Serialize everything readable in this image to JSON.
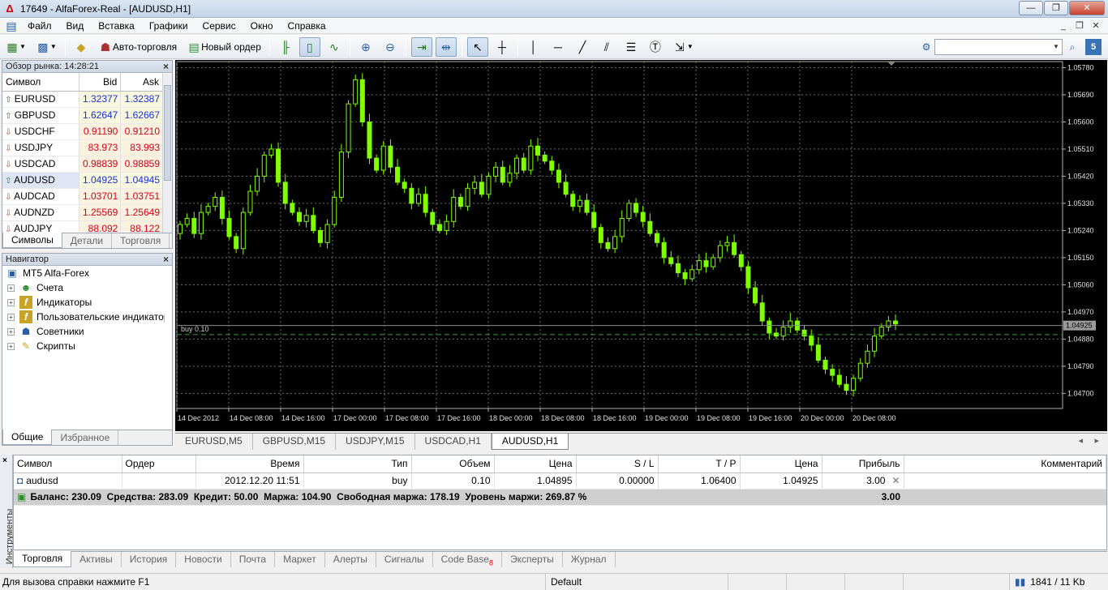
{
  "window": {
    "title": "17649 - AlfaForex-Real - [AUDUSD,H1]"
  },
  "menu": [
    "Файл",
    "Вид",
    "Вставка",
    "Графики",
    "Сервис",
    "Окно",
    "Справка"
  ],
  "toolbar": {
    "auto_trading": "Авто-торговля",
    "new_order": "Новый ордер"
  },
  "market_watch": {
    "title": "Обзор рынка: 14:28:21",
    "columns": {
      "symbol": "Символ",
      "bid": "Bid",
      "ask": "Ask"
    },
    "rows": [
      {
        "symbol": "EURUSD",
        "bid": "1.32377",
        "ask": "1.32387",
        "dir": "up"
      },
      {
        "symbol": "GBPUSD",
        "bid": "1.62647",
        "ask": "1.62667",
        "dir": "up"
      },
      {
        "symbol": "USDCHF",
        "bid": "0.91190",
        "ask": "0.91210",
        "dir": "down"
      },
      {
        "symbol": "USDJPY",
        "bid": "83.973",
        "ask": "83.993",
        "dir": "down"
      },
      {
        "symbol": "USDCAD",
        "bid": "0.98839",
        "ask": "0.98859",
        "dir": "down"
      },
      {
        "symbol": "AUDUSD",
        "bid": "1.04925",
        "ask": "1.04945",
        "dir": "up"
      },
      {
        "symbol": "AUDCAD",
        "bid": "1.03701",
        "ask": "1.03751",
        "dir": "down"
      },
      {
        "symbol": "AUDNZD",
        "bid": "1.25569",
        "ask": "1.25649",
        "dir": "down"
      },
      {
        "symbol": "AUDJPY",
        "bid": "88.092",
        "ask": "88.122",
        "dir": "down"
      }
    ],
    "tabs": [
      "Символы",
      "Детали",
      "Торговля"
    ],
    "colors": {
      "bid_up": "#1a2fd6",
      "bid_down": "#d6001a"
    }
  },
  "navigator": {
    "title": "Навигатор",
    "root": "MT5 Alfa-Forex",
    "items": [
      "Счета",
      "Индикаторы",
      "Пользовательские индикаторы",
      "Советники",
      "Скрипты"
    ],
    "tabs": [
      "Общие",
      "Избранное"
    ]
  },
  "chart": {
    "position_label": "buy 0.10",
    "current_price": "1.04925",
    "y_ticks": [
      "1.05780",
      "1.05690",
      "1.05600",
      "1.05510",
      "1.05420",
      "1.05330",
      "1.05240",
      "1.05150",
      "1.05060",
      "1.04970",
      "1.04880",
      "1.04790",
      "1.04700"
    ],
    "x_ticks": [
      "14 Dec 2012",
      "14 Dec 08:00",
      "14 Dec 16:00",
      "17 Dec 00:00",
      "17 Dec 08:00",
      "17 Dec 16:00",
      "18 Dec 00:00",
      "18 Dec 08:00",
      "18 Dec 16:00",
      "19 Dec 00:00",
      "19 Dec 08:00",
      "19 Dec 16:00",
      "20 Dec 00:00",
      "20 Dec 08:00"
    ],
    "tabs": [
      "EURUSD,M5",
      "GBPUSD,M15",
      "USDJPY,M15",
      "USDCAD,H1",
      "AUDUSD,H1"
    ],
    "colors": {
      "background": "#000000",
      "candle": "#7fff00",
      "grid": "#6e6e6e"
    }
  },
  "chart_data": {
    "type": "candlestick",
    "symbol": "AUDUSD",
    "timeframe": "H1",
    "ylim": [
      1.0465,
      1.058
    ],
    "position_price": 1.04895,
    "current_bid": 1.04925,
    "close_prices": [
      1.0526,
      1.0528,
      1.0523,
      1.053,
      1.0532,
      1.0535,
      1.0528,
      1.0522,
      1.0518,
      1.053,
      1.0537,
      1.0542,
      1.0549,
      1.0551,
      1.054,
      1.0533,
      1.053,
      1.0527,
      1.0529,
      1.0524,
      1.052,
      1.0526,
      1.0535,
      1.055,
      1.0566,
      1.0574,
      1.056,
      1.0548,
      1.0544,
      1.0552,
      1.0545,
      1.054,
      1.0538,
      1.0533,
      1.0536,
      1.053,
      1.0526,
      1.0524,
      1.0527,
      1.0535,
      1.0532,
      1.0538,
      1.054,
      1.0536,
      1.0542,
      1.0545,
      1.054,
      1.0543,
      1.0548,
      1.0544,
      1.0552,
      1.0549,
      1.0547,
      1.0544,
      1.054,
      1.0536,
      1.0532,
      1.0534,
      1.053,
      1.0525,
      1.052,
      1.0518,
      1.0522,
      1.0528,
      1.0533,
      1.053,
      1.0527,
      1.0523,
      1.052,
      1.0515,
      1.0513,
      1.051,
      1.0508,
      1.0511,
      1.0514,
      1.0512,
      1.0515,
      1.0519,
      1.052,
      1.0516,
      1.0512,
      1.0505,
      1.05,
      1.0494,
      1.049,
      1.0489,
      1.0492,
      1.0494,
      1.0491,
      1.0489,
      1.0486,
      1.0481,
      1.0478,
      1.0476,
      1.0473,
      1.0471,
      1.0475,
      1.048,
      1.0484,
      1.0489,
      1.0492,
      1.0494,
      1.0493
    ]
  },
  "terminal": {
    "side_label": "Инструменты",
    "columns": [
      "Символ",
      "Ордер",
      "Время",
      "Тип",
      "Объем",
      "Цена",
      "S / L",
      "T / P",
      "Цена",
      "Прибыль",
      "Комментарий"
    ],
    "row": {
      "symbol": "audusd",
      "order": "",
      "time": "2012.12.20 11:51",
      "type": "buy",
      "volume": "0.10",
      "price": "1.04895",
      "sl": "0.00000",
      "tp": "1.06400",
      "cur_price": "1.04925",
      "profit": "3.00",
      "comment": ""
    },
    "balance_line": "Баланс: 230.09  Средства: 283.09  Кредит: 50.00  Маржа: 104.90  Свободная маржа: 178.19  Уровень маржи: 269.87 %",
    "balance_profit": "3.00",
    "tabs": [
      "Торговля",
      "Активы",
      "История",
      "Новости",
      "Почта",
      "Маркет",
      "Алерты",
      "Сигналы",
      "Code Base",
      "Эксперты",
      "Журнал"
    ],
    "code_base_badge": "8"
  },
  "status": {
    "help": "Для вызова справки нажмите F1",
    "profile": "Default",
    "traffic": "1841 / 11 Kb"
  }
}
